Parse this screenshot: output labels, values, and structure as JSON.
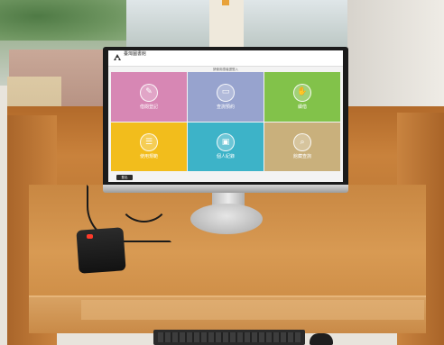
{
  "kiosk": {
    "site_name": "臺灣圖書館",
    "notice": "請使用讀者證登入",
    "logout_label": "登出",
    "tiles": [
      {
        "label": "借閱登記",
        "color": "#d787b4",
        "icon": "pen-edit-icon"
      },
      {
        "label": "查詢預約",
        "color": "#97a3ce",
        "icon": "monitor-icon"
      },
      {
        "label": "續借",
        "color": "#82c24a",
        "icon": "hand-book-icon"
      },
      {
        "label": "使用規範",
        "color": "#f2bd1c",
        "icon": "document-icon"
      },
      {
        "label": "個人紀錄",
        "color": "#3db3c8",
        "icon": "screen-chat-icon"
      },
      {
        "label": "館藏查詢",
        "color": "#c9b07c",
        "icon": "search-globe-icon"
      }
    ]
  },
  "colors": {
    "desk": "#c88742",
    "monitor_bezel": "#1b1b1b",
    "card_reader_led": "#ff3a2a"
  }
}
